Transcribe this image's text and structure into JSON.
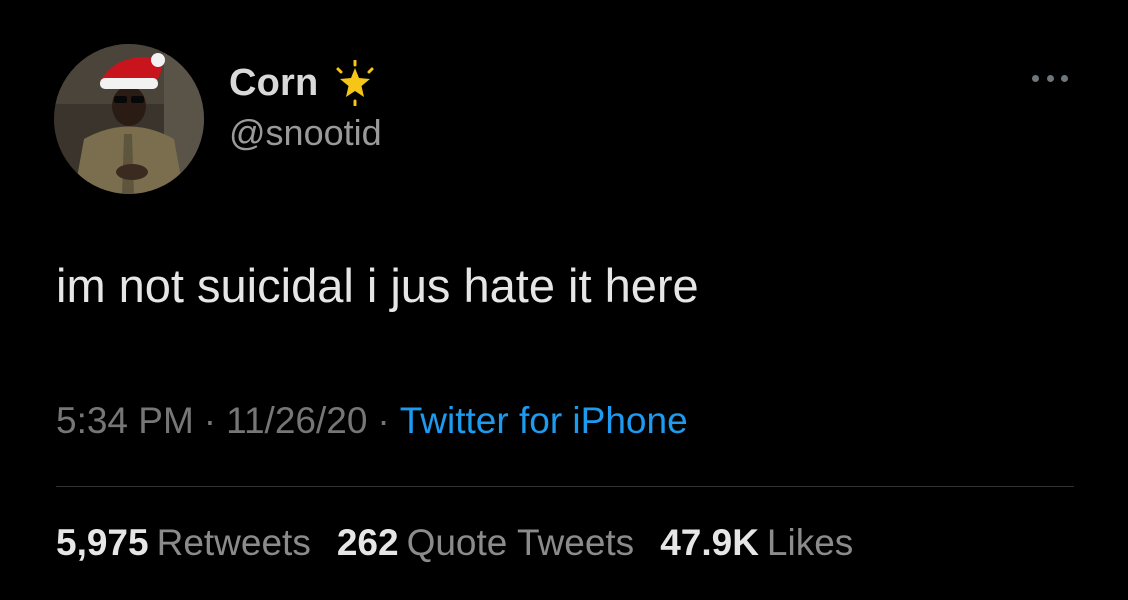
{
  "user": {
    "display_name": "Corn",
    "handle": "@snootid",
    "badge_icon": "sparkle-star-icon",
    "avatar_icon": "person-santa-hat-avatar"
  },
  "menu": {
    "icon": "more-options-icon"
  },
  "tweet": {
    "text": "im not suicidal i jus hate it here",
    "time": "5:34 PM",
    "separator": "·",
    "date": "11/26/20",
    "source": "Twitter for iPhone"
  },
  "stats": {
    "retweets_count": "5,975",
    "retweets_label": "Retweets",
    "quote_tweets_count": "262",
    "quote_tweets_label": "Quote Tweets",
    "likes_count": "47.9K",
    "likes_label": "Likes"
  },
  "colors": {
    "background": "#000000",
    "primary_text": "#e6e6e6",
    "secondary_text": "#767676",
    "link": "#1d9bf0",
    "star": "#f5c518"
  }
}
